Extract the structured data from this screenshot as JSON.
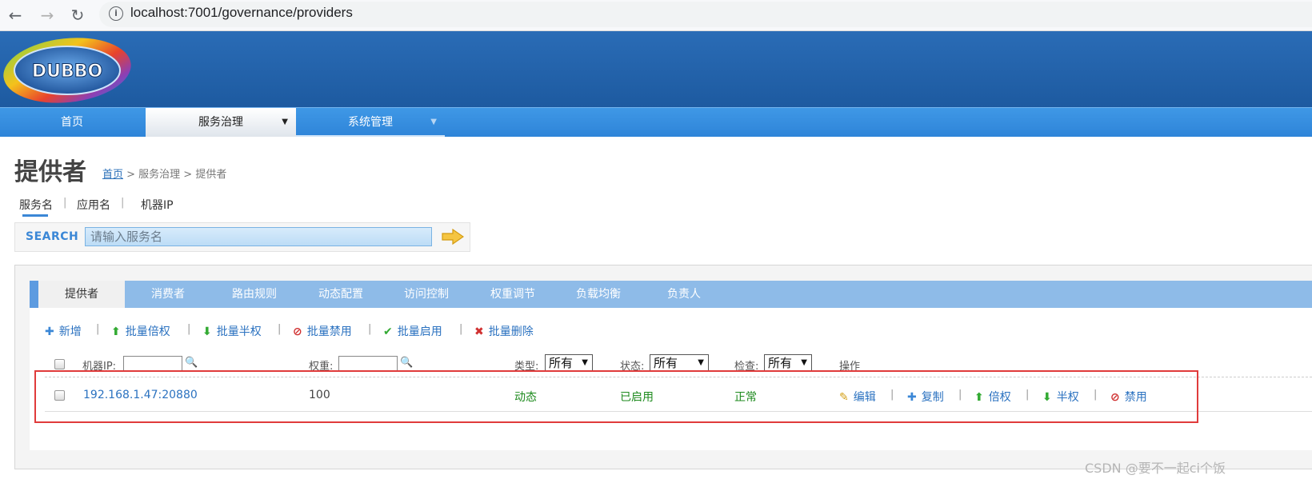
{
  "browser": {
    "url": "localhost:7001/governance/providers",
    "back_icon": "arrow-left-icon",
    "forward_icon": "arrow-right-icon",
    "reload_icon": "reload-icon",
    "info_icon": "info-icon"
  },
  "logo": {
    "text": "DUBBO"
  },
  "nav": {
    "items": [
      {
        "label": "首页"
      },
      {
        "label": "服务治理"
      },
      {
        "label": "系统管理"
      }
    ]
  },
  "page": {
    "title": "提供者",
    "breadcrumb": {
      "home": "首页",
      "rest": " > 服务治理 > 提供者"
    }
  },
  "search": {
    "tabs": [
      {
        "label": "服务名"
      },
      {
        "label": "应用名"
      },
      {
        "label": "机器IP"
      }
    ],
    "separator": "|",
    "label": "SEARCH",
    "placeholder": "请输入服务名"
  },
  "panel_tabs": [
    {
      "label": "提供者"
    },
    {
      "label": "消费者"
    },
    {
      "label": "路由规则"
    },
    {
      "label": "动态配置"
    },
    {
      "label": "访问控制"
    },
    {
      "label": "权重调节"
    },
    {
      "label": "负载均衡"
    },
    {
      "label": "负责人"
    }
  ],
  "actions": [
    {
      "label": "新增",
      "icon": "plus-icon",
      "glyph": "✚",
      "color": "#3b87d6"
    },
    {
      "label": "批量倍权",
      "icon": "arrow-up-icon",
      "glyph": "⬆",
      "color": "#33aa33"
    },
    {
      "label": "批量半权",
      "icon": "arrow-down-icon",
      "glyph": "⬇",
      "color": "#33aa33"
    },
    {
      "label": "批量禁用",
      "icon": "ban-icon",
      "glyph": "⊘",
      "color": "#d03030"
    },
    {
      "label": "批量启用",
      "icon": "check-icon",
      "glyph": "✔",
      "color": "#33aa33"
    },
    {
      "label": "批量删除",
      "icon": "delete-x-icon",
      "glyph": "✖",
      "color": "#d03030"
    }
  ],
  "table": {
    "headers": {
      "ip": "机器IP:",
      "weight": "权重:",
      "type": "类型:",
      "status": "状态:",
      "check": "检查:",
      "ops": "操作"
    },
    "filters": {
      "type": "所有",
      "status": "所有",
      "check": "所有"
    },
    "rows": [
      {
        "ip": "192.168.1.47:20880",
        "weight": "100",
        "type": "动态",
        "status": "已启用",
        "check": "正常",
        "ops": [
          {
            "label": "编辑",
            "icon": "pencil-icon",
            "glyph": "✎",
            "color": "#d4a017"
          },
          {
            "label": "复制",
            "icon": "plus-icon",
            "glyph": "✚",
            "color": "#3b87d6"
          },
          {
            "label": "倍权",
            "icon": "arrow-up-icon",
            "glyph": "⬆",
            "color": "#33aa33"
          },
          {
            "label": "半权",
            "icon": "arrow-down-icon",
            "glyph": "⬇",
            "color": "#33aa33"
          },
          {
            "label": "禁用",
            "icon": "ban-icon",
            "glyph": "⊘",
            "color": "#d03030"
          }
        ]
      }
    ]
  },
  "watermark": "CSDN @要不一起ci个饭",
  "colors": {
    "header": "#1d5aa0",
    "nav": "#2e84d8",
    "tabs": "#8ebbe8",
    "link": "#2b72c0",
    "highlight": "#e03b3b"
  }
}
